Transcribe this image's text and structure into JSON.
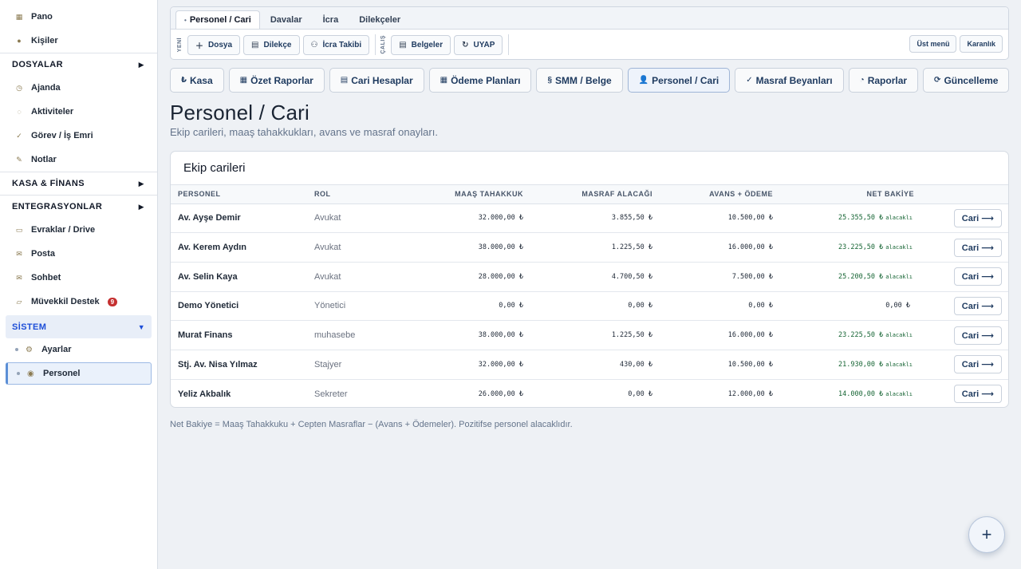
{
  "sidebar": {
    "top_items": [
      {
        "label": "Pano",
        "icon": "dashboard-icon"
      },
      {
        "label": "Kişiler",
        "icon": "people-icon"
      }
    ],
    "sections": [
      {
        "label": "DOSYALAR",
        "arrow": "▶"
      },
      {
        "label": "KASA & FİNANS",
        "arrow": "▶"
      },
      {
        "label": "ENTEGRASYONLAR",
        "arrow": "▶"
      },
      {
        "label": "SİSTEM",
        "arrow": "▼"
      }
    ],
    "dosyalar_items": [
      {
        "label": "Ajanda",
        "icon": "calendar-icon"
      },
      {
        "label": "Aktiviteler",
        "icon": "activity-icon"
      },
      {
        "label": "Görev / İş Emri",
        "icon": "check-icon"
      },
      {
        "label": "Notlar",
        "icon": "pencil-icon"
      }
    ],
    "integration_items": [
      {
        "label": "Evraklar / Drive",
        "icon": "folder-icon"
      },
      {
        "label": "Posta",
        "icon": "mail-icon"
      },
      {
        "label": "Sohbet",
        "icon": "chat-icon"
      },
      {
        "label": "Müvekkil Destek",
        "icon": "support-icon",
        "badge": "9"
      }
    ],
    "system_items": [
      {
        "label": "Ayarlar",
        "icon": "gear-icon"
      },
      {
        "label": "Personel",
        "icon": "personnel-icon"
      }
    ]
  },
  "toolbar": {
    "tabs": [
      "Personel / Cari",
      "Davalar",
      "İcra",
      "Dilekçeler"
    ],
    "label_yeni": "YENİ",
    "label_calis": "ÇALIŞ",
    "buttons": [
      "Dosya",
      "Dilekçe",
      "İcra Takibi",
      "Belgeler",
      "UYAP"
    ],
    "right_buttons": [
      "Üst menü",
      "Karanlık"
    ]
  },
  "modules": [
    "Kasa",
    "Özet Raporlar",
    "Cari Hesaplar",
    "Ödeme Planları",
    "SMM / Belge",
    "Personel / Cari",
    "Masraf Beyanları",
    "Raporlar",
    "Güncelleme"
  ],
  "module_icons": [
    "₺",
    "▦",
    "▤",
    "▦",
    "§",
    "👤",
    "✓",
    "◔",
    "⟳"
  ],
  "page": {
    "title": "Personel / Cari",
    "subtitle": "Ekip carileri, maaş tahakkukları, avans ve masraf onayları."
  },
  "card": {
    "title": "Ekip carileri",
    "columns": [
      "PERSONEL",
      "ROL",
      "MAAŞ TAHAKKUK",
      "MASRAF ALACAĞI",
      "AVANS + ÖDEME",
      "NET BAKİYE"
    ],
    "rows": [
      {
        "name": "Av. Ayşe Demir",
        "rol": "Avukat",
        "maas": "32.000,00 ₺",
        "masraf": "3.855,50 ₺",
        "avans": "10.500,00 ₺",
        "net": "25.355,50 ₺",
        "net_suffix": "alacaklı",
        "button": "Cari ⟶"
      },
      {
        "name": "Av. Kerem Aydın",
        "rol": "Avukat",
        "maas": "38.000,00 ₺",
        "masraf": "1.225,50 ₺",
        "avans": "16.000,00 ₺",
        "net": "23.225,50 ₺",
        "net_suffix": "alacaklı",
        "button": "Cari ⟶"
      },
      {
        "name": "Av. Selin Kaya",
        "rol": "Avukat",
        "maas": "28.000,00 ₺",
        "masraf": "4.700,50 ₺",
        "avans": "7.500,00 ₺",
        "net": "25.200,50 ₺",
        "net_suffix": "alacaklı",
        "button": "Cari ⟶"
      },
      {
        "name": "Demo Yönetici",
        "rol": "Yönetici",
        "maas": "0,00 ₺",
        "masraf": "0,00 ₺",
        "avans": "0,00 ₺",
        "net": "0,00 ₺",
        "net_suffix": "",
        "button": "Cari ⟶"
      },
      {
        "name": "Murat Finans",
        "rol": "muhasebe",
        "maas": "38.000,00 ₺",
        "masraf": "1.225,50 ₺",
        "avans": "16.000,00 ₺",
        "net": "23.225,50 ₺",
        "net_suffix": "alacaklı",
        "button": "Cari ⟶"
      },
      {
        "name": "Stj. Av. Nisa Yılmaz",
        "rol": "Stajyer",
        "maas": "32.000,00 ₺",
        "masraf": "430,00 ₺",
        "avans": "10.500,00 ₺",
        "net": "21.930,00 ₺",
        "net_suffix": "alacaklı",
        "button": "Cari ⟶"
      },
      {
        "name": "Yeliz Akbalık",
        "rol": "Sekreter",
        "maas": "26.000,00 ₺",
        "masraf": "0,00 ₺",
        "avans": "12.000,00 ₺",
        "net": "14.000,00 ₺",
        "net_suffix": "alacaklı",
        "button": "Cari ⟶"
      }
    ]
  },
  "footnote": "Net Bakiye = Maaş Tahakkuku + Cepten Masraflar − (Avans + Ödemeler). Pozitifse personel alacaklıdır.",
  "fab": "+",
  "colors": {
    "accent": "#1d4ed8",
    "positive": "#166534",
    "badge": "#c53030"
  }
}
